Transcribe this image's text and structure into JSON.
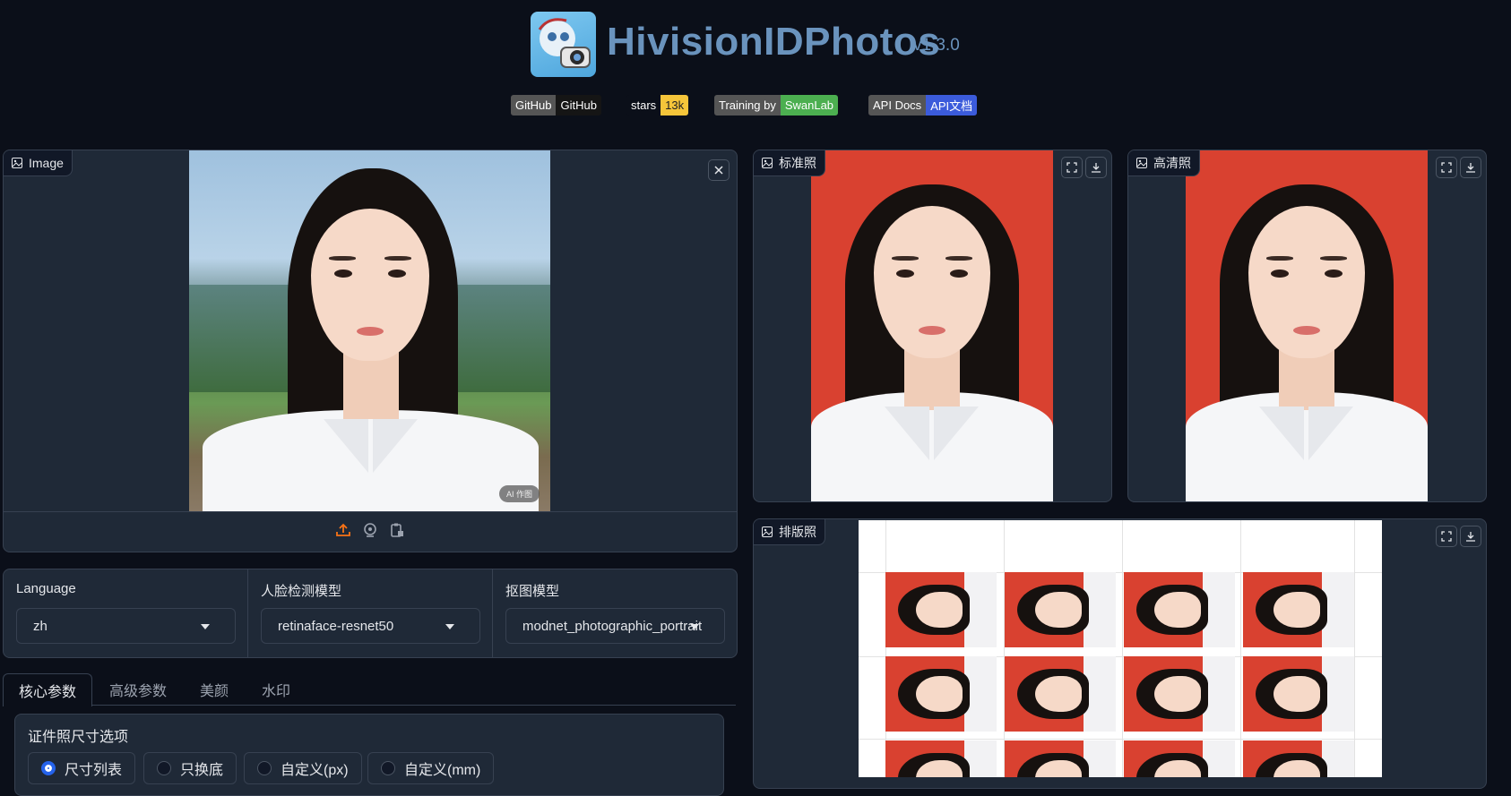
{
  "header": {
    "title": "HivisionIDPhotos",
    "version": "v1.3.0",
    "badges": [
      {
        "left": "GitHub",
        "right": "GitHub"
      },
      {
        "left": "stars",
        "right": "13k"
      },
      {
        "left": "Training by",
        "right": "SwanLab"
      },
      {
        "left": "API Docs",
        "right": "API文档"
      }
    ]
  },
  "upload_panel": {
    "label": "Image",
    "ai_tag": "AI 作图",
    "icons": [
      "upload-icon",
      "webcam-icon",
      "clipboard-icon",
      "close-icon"
    ]
  },
  "outputs": {
    "standard_label": "标准照",
    "hd_label": "高清照",
    "layout_label": "排版照"
  },
  "settings": {
    "language_label": "Language",
    "language_value": "zh",
    "face_model_label": "人脸检测模型",
    "face_model_value": "retinaface-resnet50",
    "matting_model_label": "抠图模型",
    "matting_model_value": "modnet_photographic_portrait"
  },
  "tabs": [
    {
      "label": "核心参数",
      "active": true
    },
    {
      "label": "高级参数",
      "active": false
    },
    {
      "label": "美颜",
      "active": false
    },
    {
      "label": "水印",
      "active": false
    }
  ],
  "core_params": {
    "size_options_label": "证件照尺寸选项",
    "radios": [
      {
        "label": "尺寸列表",
        "checked": true
      },
      {
        "label": "只换底",
        "checked": false
      },
      {
        "label": "自定义(px)",
        "checked": false
      },
      {
        "label": "自定义(mm)",
        "checked": false
      }
    ]
  },
  "colors": {
    "background": "#0b0f19",
    "panel": "#1f2937",
    "title": "#6a93bd",
    "id_red": "#d94130",
    "swanlab_green": "#4caf50",
    "stars_yellow": "#f5c53a",
    "api_blue": "#3b5bdb"
  }
}
